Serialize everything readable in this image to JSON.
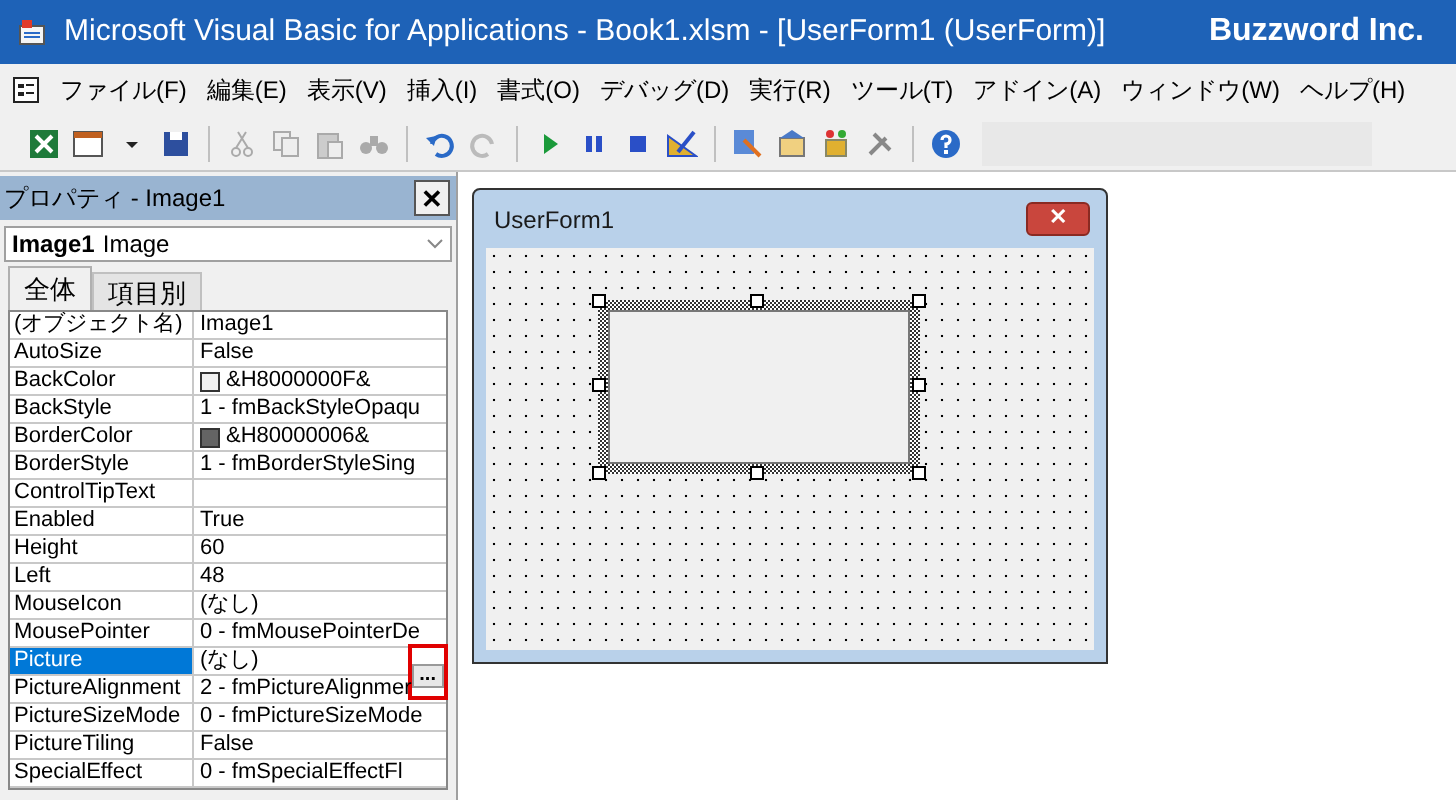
{
  "window": {
    "title": "Microsoft Visual Basic for Applications - Book1.xlsm - [UserForm1 (UserForm)]",
    "brand": "Buzzword Inc."
  },
  "menu": [
    "ファイル(F)",
    "編集(E)",
    "表示(V)",
    "挿入(I)",
    "書式(O)",
    "デバッグ(D)",
    "実行(R)",
    "ツール(T)",
    "アドイン(A)",
    "ウィンドウ(W)",
    "ヘルプ(H)"
  ],
  "properties": {
    "title": "プロパティ - Image1",
    "close": "✕",
    "object_name": "Image1",
    "object_type": "Image",
    "tabs": [
      {
        "label": "全体",
        "selected": true
      },
      {
        "label": "項目別",
        "selected": false
      }
    ],
    "rows": [
      {
        "name": "(オブジェクト名)",
        "value": "Image1",
        "selected": false
      },
      {
        "name": "AutoSize",
        "value": "False",
        "selected": false
      },
      {
        "name": "BackColor",
        "value": "&H8000000F&",
        "color": "#f0f0f0",
        "selected": false
      },
      {
        "name": "BackStyle",
        "value": "1 - fmBackStyleOpaqu",
        "selected": false
      },
      {
        "name": "BorderColor",
        "value": "&H80000006&",
        "color": "#646464",
        "selected": false
      },
      {
        "name": "BorderStyle",
        "value": "1 - fmBorderStyleSing",
        "selected": false
      },
      {
        "name": "ControlTipText",
        "value": "",
        "selected": false
      },
      {
        "name": "Enabled",
        "value": "True",
        "selected": false
      },
      {
        "name": "Height",
        "value": "60",
        "selected": false
      },
      {
        "name": "Left",
        "value": "48",
        "selected": false
      },
      {
        "name": "MouseIcon",
        "value": "(なし)",
        "selected": false
      },
      {
        "name": "MousePointer",
        "value": "0 - fmMousePointerDe",
        "selected": false
      },
      {
        "name": "Picture",
        "value": "(なし)",
        "selected": true,
        "button": "...",
        "highlighted": true
      },
      {
        "name": "PictureAlignment",
        "value": "2 - fmPictureAlignmer",
        "selected": false
      },
      {
        "name": "PictureSizeMode",
        "value": "0 - fmPictureSizeMode",
        "selected": false
      },
      {
        "name": "PictureTiling",
        "value": "False",
        "selected": false
      },
      {
        "name": "SpecialEffect",
        "value": "0 - fmSpecialEffectFl",
        "selected": false
      }
    ]
  },
  "form": {
    "title": "UserForm1",
    "close": "✕"
  }
}
